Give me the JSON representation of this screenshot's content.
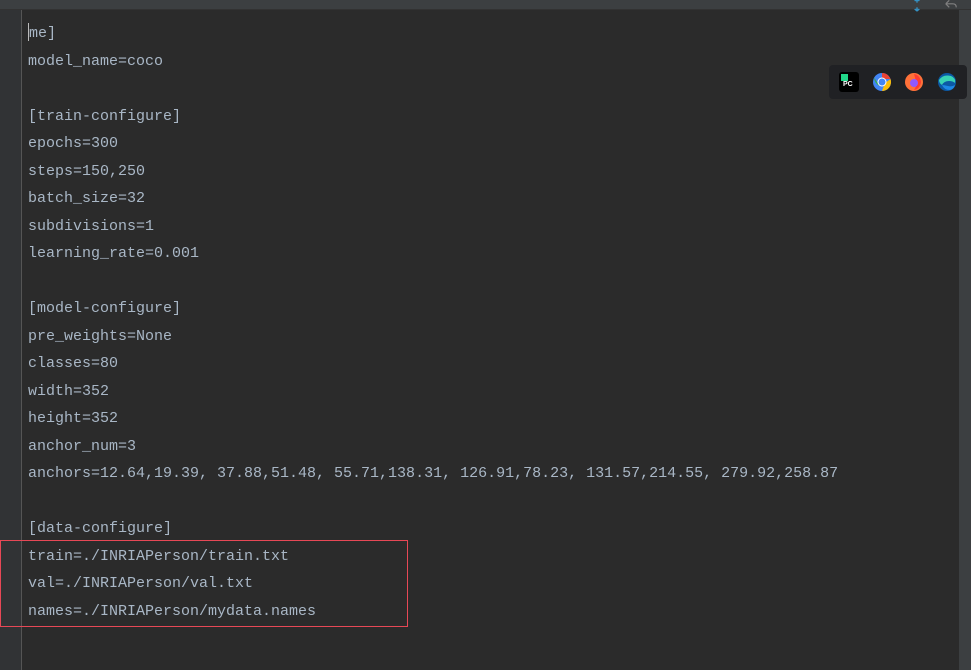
{
  "editor": {
    "lines": [
      "me]",
      "model_name=coco",
      "",
      "[train-configure]",
      "epochs=300",
      "steps=150,250",
      "batch_size=32",
      "subdivisions=1",
      "learning_rate=0.001",
      "",
      "[model-configure]",
      "pre_weights=None",
      "classes=80",
      "width=352",
      "height=352",
      "anchor_num=3",
      "anchors=12.64,19.39, 37.88,51.48, 55.71,138.31, 126.91,78.23, 131.57,214.55, 279.92,258.87",
      "",
      "[data-configure]",
      "train=./INRIAPerson/train.txt",
      "val=./INRIAPerson/val.txt",
      "names=./INRIAPerson/mydata.names"
    ]
  },
  "apps": {
    "pycharm": "PyCharm",
    "chrome": "Google Chrome",
    "firefox": "Firefox",
    "edge": "Microsoft Edge"
  }
}
